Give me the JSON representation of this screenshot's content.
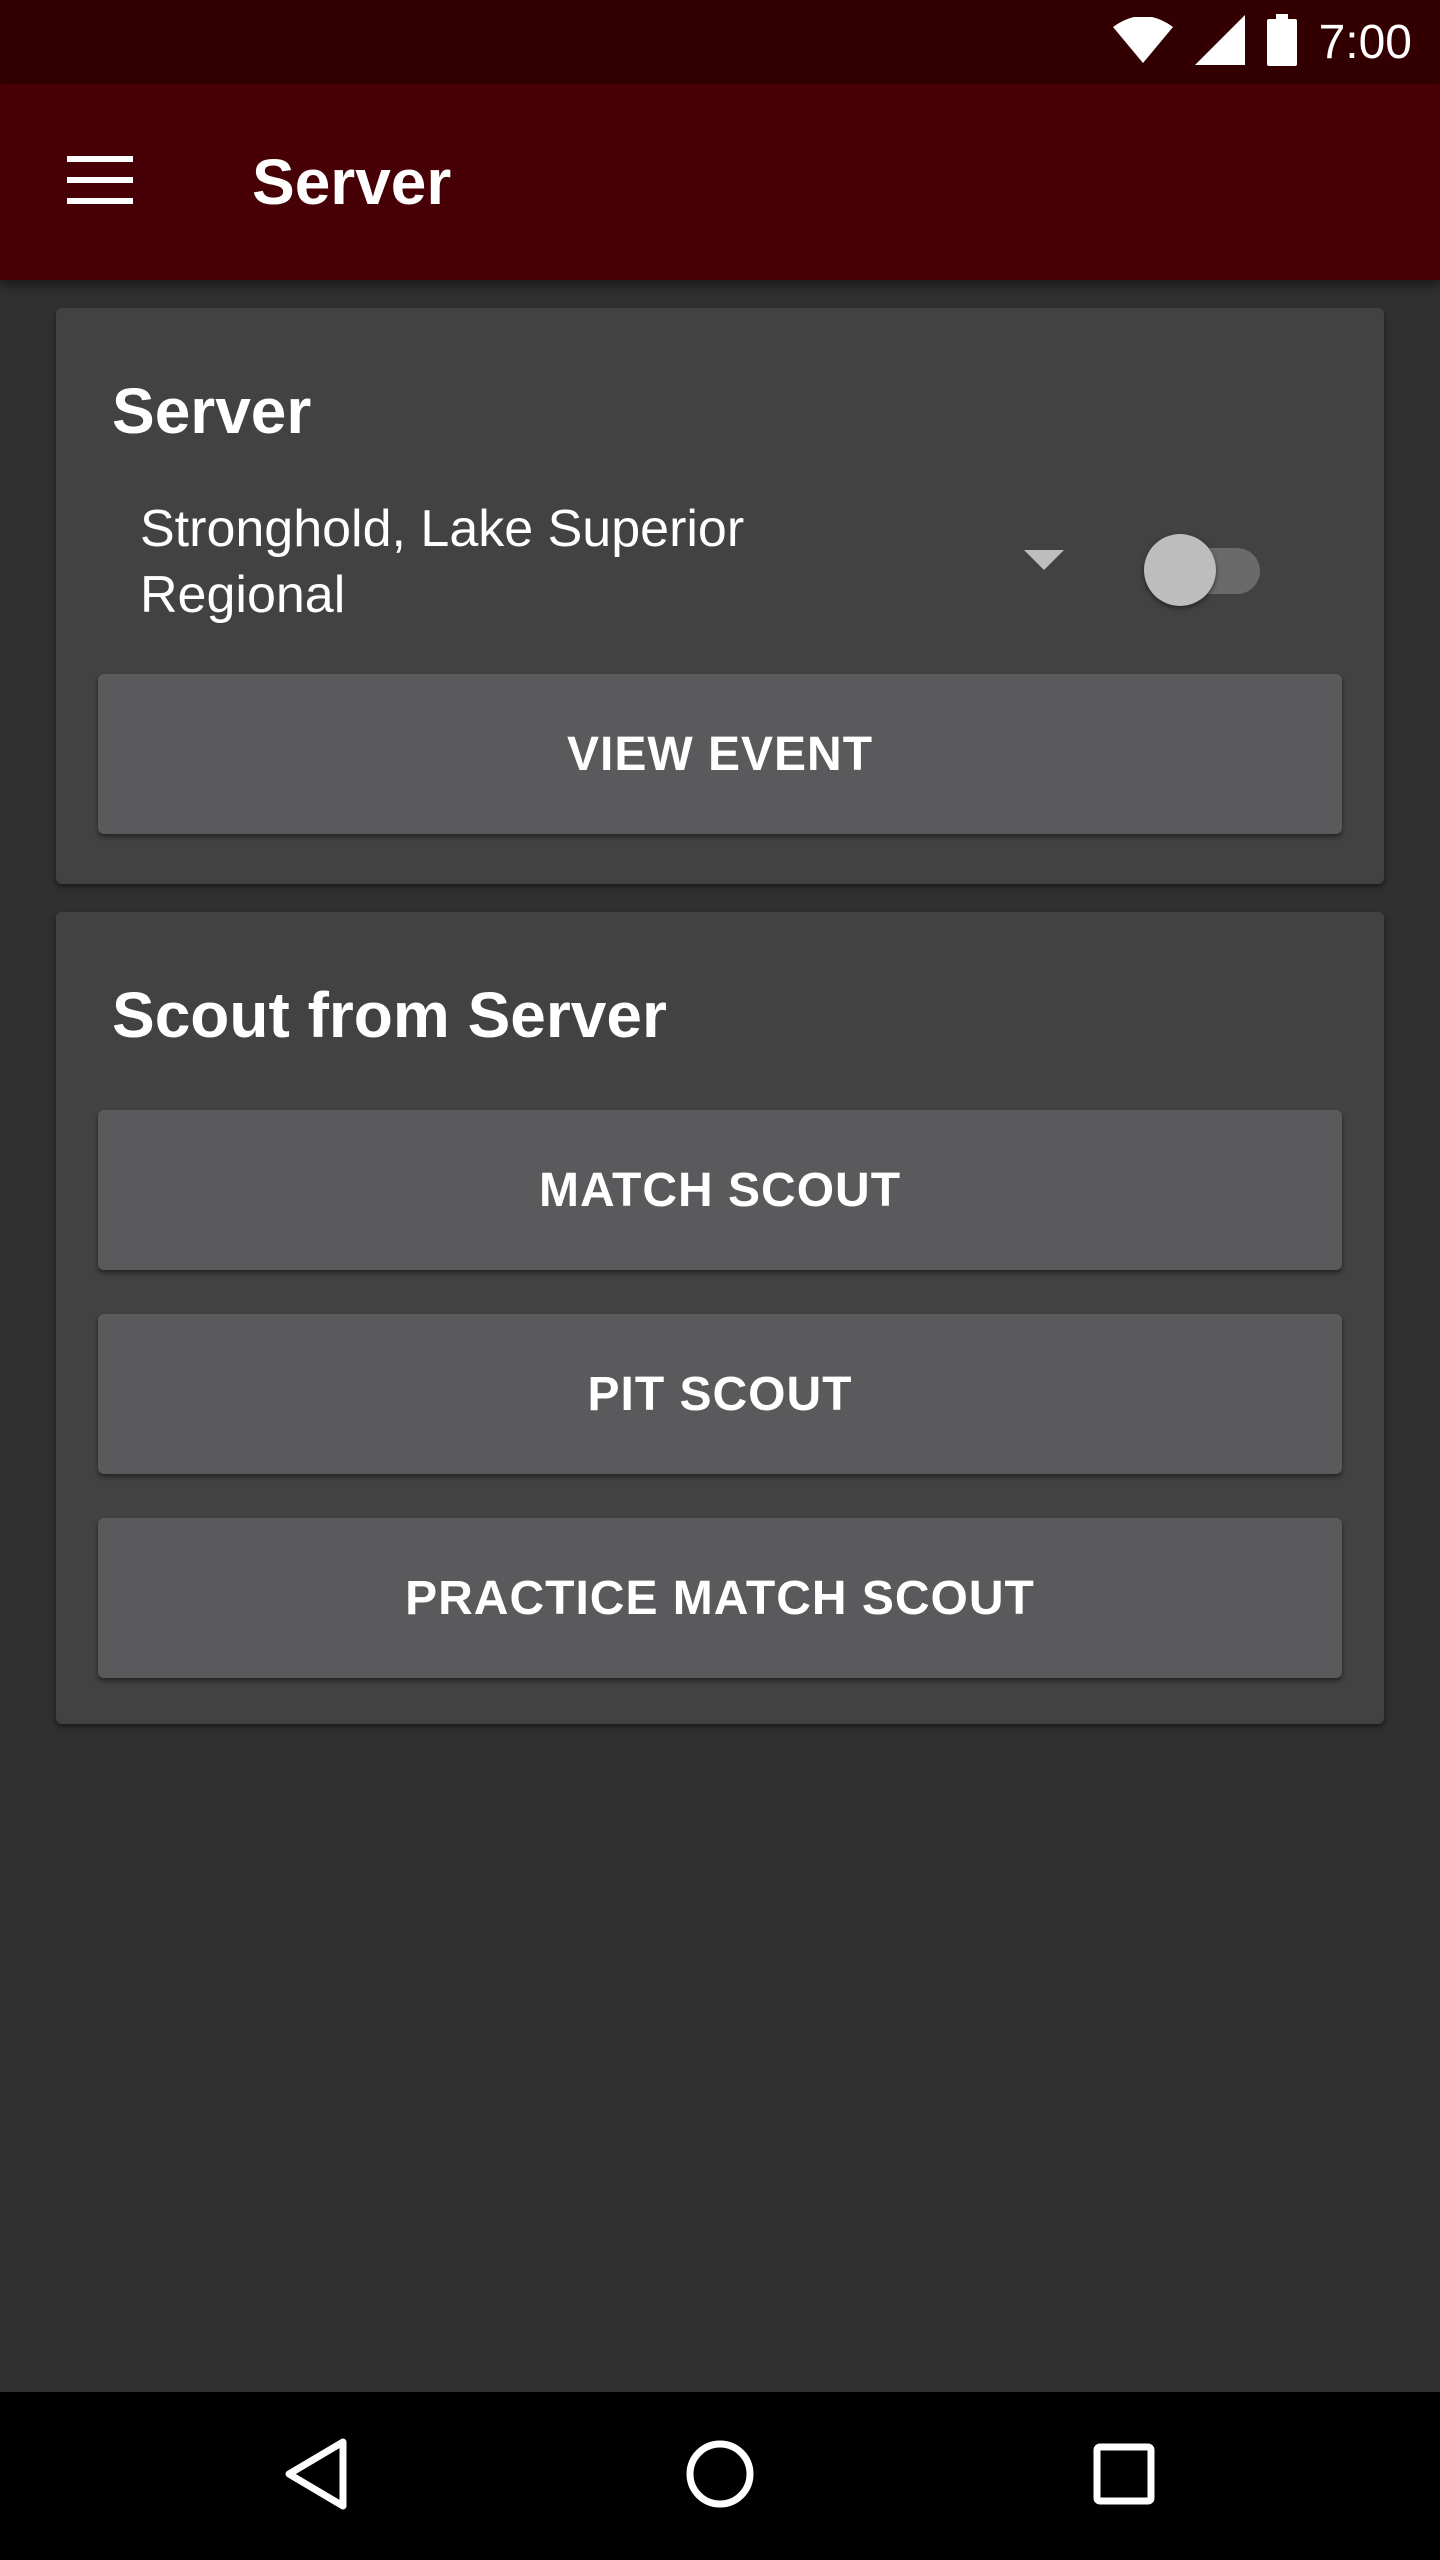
{
  "status_bar": {
    "time": "7:00",
    "icons": [
      "wifi-icon",
      "cell-signal-icon",
      "battery-icon"
    ]
  },
  "app_bar": {
    "title": "Server",
    "menu_icon": "menu-icon"
  },
  "server_card": {
    "title": "Server",
    "event_select": {
      "selected_value": "Stronghold, Lake Superior Regional"
    },
    "toggle": {
      "on": false
    },
    "view_event_label": "VIEW EVENT"
  },
  "scout_card": {
    "title": "Scout from Server",
    "buttons": {
      "match_scout": "MATCH SCOUT",
      "pit_scout": "PIT SCOUT",
      "practice_match_scout": "PRACTICE MATCH SCOUT"
    }
  },
  "nav_bar": {
    "icons": [
      "back-icon",
      "home-icon",
      "recents-icon"
    ]
  },
  "colors": {
    "status_bar": "#320000",
    "app_bar": "#470005",
    "background": "#303030",
    "card": "#424242",
    "button": "#5a5a5c"
  }
}
